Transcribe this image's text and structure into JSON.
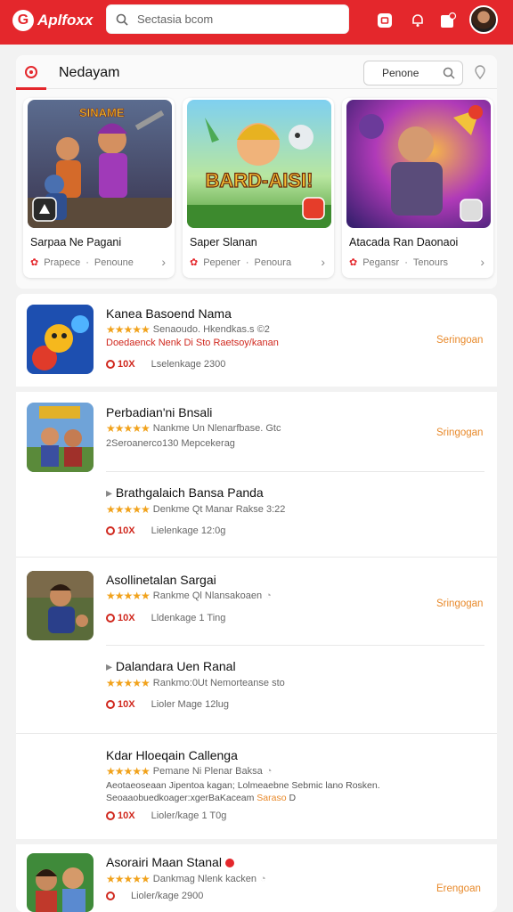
{
  "header": {
    "logo_letter": "G",
    "app_name": "Aplfoxx",
    "search_placeholder": "Sectasia bcom",
    "icons": [
      "search-icon",
      "square-icon",
      "bell-icon",
      "bookmark-icon"
    ]
  },
  "colors": {
    "brand": "#e4272c",
    "accent_orange": "#e8892a",
    "star": "#f1a21b"
  },
  "featured": {
    "title": "Nedayam",
    "filter_label": "Penone",
    "cards": [
      {
        "title": "Sarpaa Ne Pagani",
        "meta_left": "Prapece",
        "meta_right": "Penoune",
        "art_text": "SINAME"
      },
      {
        "title": "Saper Slanan",
        "meta_left": "Pepener",
        "meta_right": "Penoura",
        "art_text": "BARD-AISI!"
      },
      {
        "title": "Atacada Ran Daonaoi",
        "meta_left": "Pegansr",
        "meta_right": "Tenours",
        "art_text": ""
      }
    ]
  },
  "apps": [
    {
      "name": "Kanea Basoend Nama",
      "rating_text": "Senaoudo. Hkendkas.s ©2",
      "sub": "Doedaenck  Nenk Di Sto Raetsoy/kanan",
      "downloads": "10X",
      "size": "Lselenkage 2300",
      "action": "Seringoan"
    },
    {
      "name": "Perbadian'ni Bnsali",
      "rating_text": "Nankme Un Nlenarfbase. Gtc",
      "sub": "2Seroanerco130 Mepcekerag",
      "action": "Sringogan"
    },
    {
      "name": "Brathgalaich Bansa Panda",
      "rating_text": "Denkme Qt Manar Rakse 3:22",
      "downloads": "10X",
      "size": "Lielenkage 12:0g"
    },
    {
      "name": "Asollinetalan Sargai",
      "rating_text": "Rankme Ql Nlansakoaen",
      "downloads": "10X",
      "size": "Lldenkage 1 Ting",
      "action": "Sringogan"
    },
    {
      "name": "Dalandara Uen Ranal",
      "rating_text": "Rankmo:0Ut Nemorteanse sto",
      "downloads": "10X",
      "size": "Lioler Mage 12lug"
    },
    {
      "name": "Kdar Hloeqain Callenga",
      "rating_text": "Pemane Ni Plenar Baksa",
      "sub": "Aeotaeoseaan Jipentoa kagan; Lolmeaebne Sebmic lano Rosken.",
      "sub2_prefix": "Seoaaobuedkoager:xgerBaKaceam",
      "sub2_highlight": "Saraso",
      "sub2_suffix": "D",
      "downloads": "10X",
      "size": "Lioler/kage 1 T0g"
    },
    {
      "name": "Asorairi Maan Stanal",
      "rating_text": "Dankmag Nlenk kacken",
      "size": "Lioler/kage 2900",
      "action": "Erengoan"
    }
  ]
}
